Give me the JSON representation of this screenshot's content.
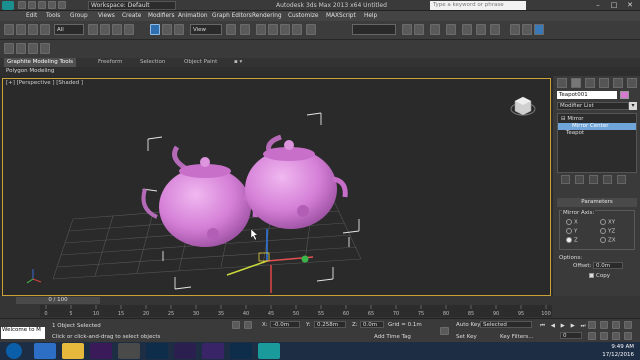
{
  "window": {
    "workspace": "Workspace: Default",
    "title": "Autodesk 3ds Max 2013 x64      Untitled",
    "search_placeholder": "Type a keyword or phrase",
    "controls": [
      "–",
      "□",
      "✕"
    ]
  },
  "menubar": {
    "items": [
      "Edit",
      "Tools",
      "Group",
      "Views",
      "Create",
      "Modifiers",
      "Animation",
      "Graph Editors",
      "Rendering",
      "Customize",
      "MAXScript",
      "Help"
    ]
  },
  "toolbar": {
    "selection_filter": "All",
    "ref_coord": "View"
  },
  "ribbon": {
    "tabs": [
      "Graphite Modeling Tools",
      "Freeform",
      "Selection",
      "Object Paint"
    ],
    "sub_panel": "Polygon Modeling"
  },
  "viewport": {
    "label": "[+] [Perspective ] [Shaded ]",
    "object_color": "#d78bd8",
    "border_color": "#c9a23a"
  },
  "command_panel": {
    "object_name": "Teapot001",
    "object_color": "#d47ad0",
    "modifier_list_label": "Modifier List",
    "stack": [
      {
        "label": "Mirror",
        "indent": 1,
        "prefix": "⊟"
      },
      {
        "label": "Mirror Center",
        "indent": 2,
        "prefix": ""
      },
      {
        "label": "Teapot",
        "indent": 1,
        "prefix": ""
      }
    ],
    "parameters_title": "Parameters",
    "mirror_axis_label": "Mirror Axis:",
    "axes": [
      "X",
      "Y",
      "Z",
      "XY",
      "YZ",
      "ZX"
    ],
    "selected_axis": "Z",
    "options_label": "Options:",
    "offset_label": "Offset:",
    "offset_value": "0.0m",
    "copy_label": "Copy",
    "copy_checked": true
  },
  "timeline": {
    "slider_label": "0 / 100",
    "ticks": [
      "0",
      "5",
      "10",
      "15",
      "20",
      "25",
      "30",
      "35",
      "40",
      "45",
      "50",
      "55",
      "60",
      "65",
      "70",
      "75",
      "80",
      "85",
      "90",
      "95",
      "100"
    ]
  },
  "statusbar": {
    "maxscript_text": "Welcome to M",
    "selection_count": "1 Object Selected",
    "prompt": "Click or click-and-drag to select objects",
    "x_label": "X:",
    "x_value": "-0.0m",
    "y_label": "Y:",
    "y_value": "0.258m",
    "z_label": "Z:",
    "z_value": "0.0m",
    "grid": "Grid = 0.1m",
    "autokey": "Auto Key",
    "autokey_value": "Selected",
    "setkey": "Set Key",
    "key_filters": "Key Filters...",
    "add_time_tag": "Add Time Tag",
    "frame": "0"
  },
  "taskbar": {
    "time": "9:49 AM",
    "date": "17/12/2016",
    "apps": [
      "ie",
      "folder",
      "pr",
      "media",
      "ps",
      "ae",
      "ae2",
      "ps2",
      "3ds"
    ]
  }
}
